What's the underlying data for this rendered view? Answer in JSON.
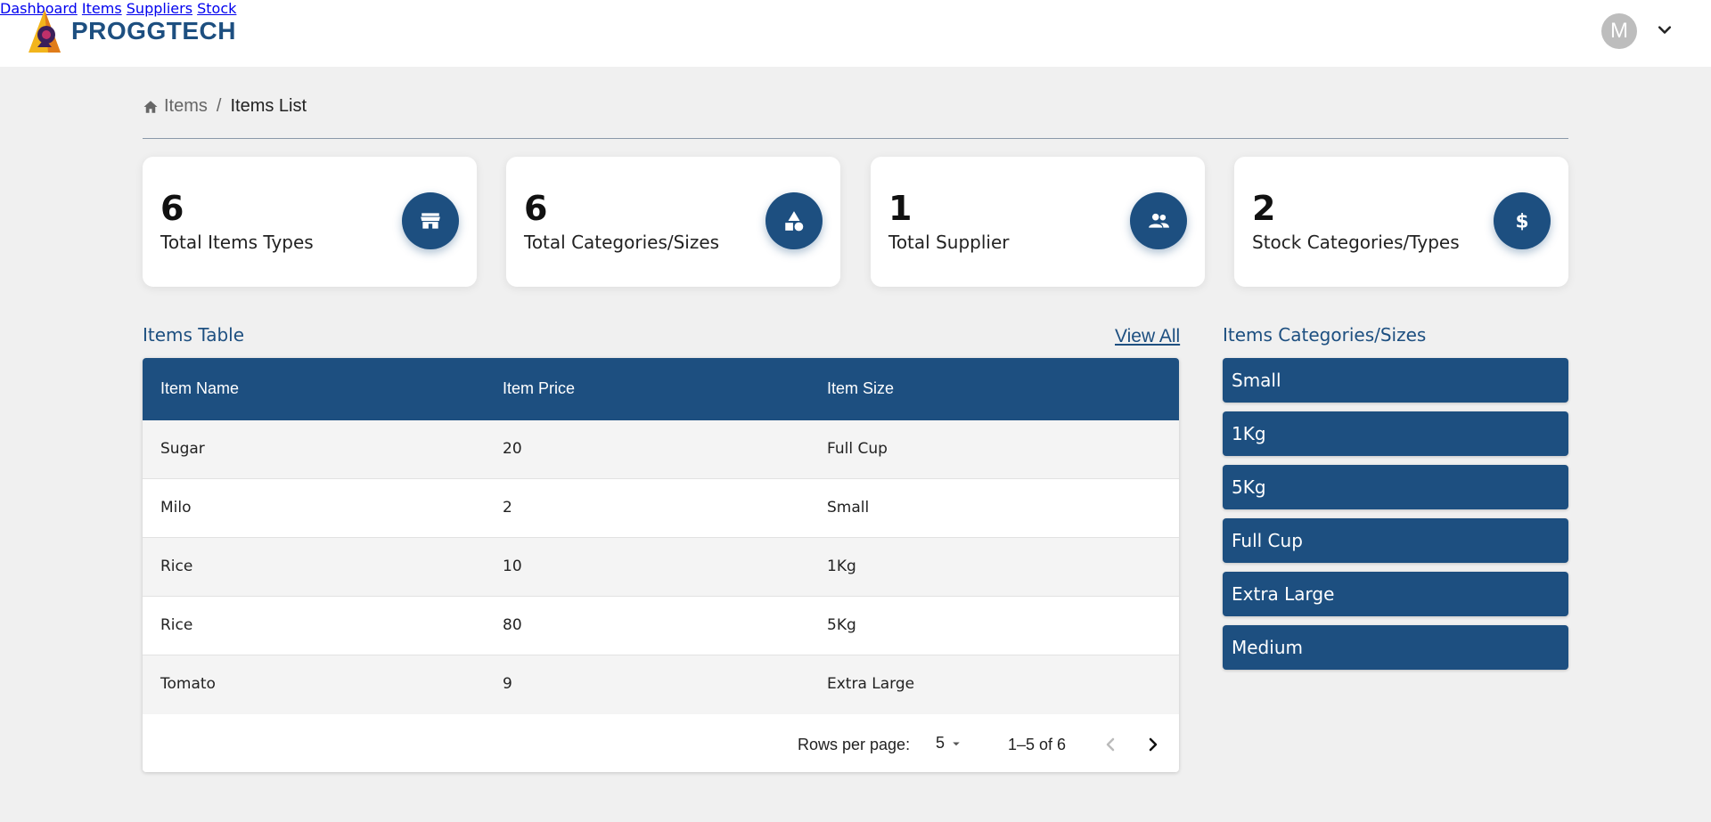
{
  "brand": {
    "name": "PROGGTECH"
  },
  "nav": {
    "links": [
      "Dashboard",
      "Items",
      "Suppliers",
      "Stock"
    ],
    "avatar_initial": "M"
  },
  "breadcrumb": {
    "root": "Items",
    "separator": "/",
    "current": "Items List"
  },
  "stats": [
    {
      "value": "6",
      "label": "Total Items Types",
      "icon": "store-icon"
    },
    {
      "value": "6",
      "label": "Total Categories/Sizes",
      "icon": "shapes-icon"
    },
    {
      "value": "1",
      "label": "Total Supplier",
      "icon": "people-icon"
    },
    {
      "value": "2",
      "label": "Stock Categories/Types",
      "icon": "dollar-icon"
    }
  ],
  "items_table": {
    "title": "Items Table",
    "view_all": "View All",
    "columns": [
      "Item Name",
      "Item Price",
      "Item Size"
    ],
    "rows": [
      [
        "Sugar",
        "20",
        "Full Cup"
      ],
      [
        "Milo",
        "2",
        "Small"
      ],
      [
        "Rice",
        "10",
        "1Kg"
      ],
      [
        "Rice",
        "80",
        "5Kg"
      ],
      [
        "Tomato",
        "9",
        "Extra Large"
      ]
    ],
    "pagination": {
      "rows_per_page_label": "Rows per page:",
      "rows_per_page": "5",
      "range": "1–5 of 6"
    }
  },
  "categories": {
    "title": "Items Categories/Sizes",
    "items": [
      "Small",
      "1Kg",
      "5Kg",
      "Full Cup",
      "Extra Large",
      "Medium"
    ]
  },
  "colors": {
    "primary": "#1d4f80",
    "background": "#f0f0f0",
    "avatar": "#bdbdbd"
  }
}
